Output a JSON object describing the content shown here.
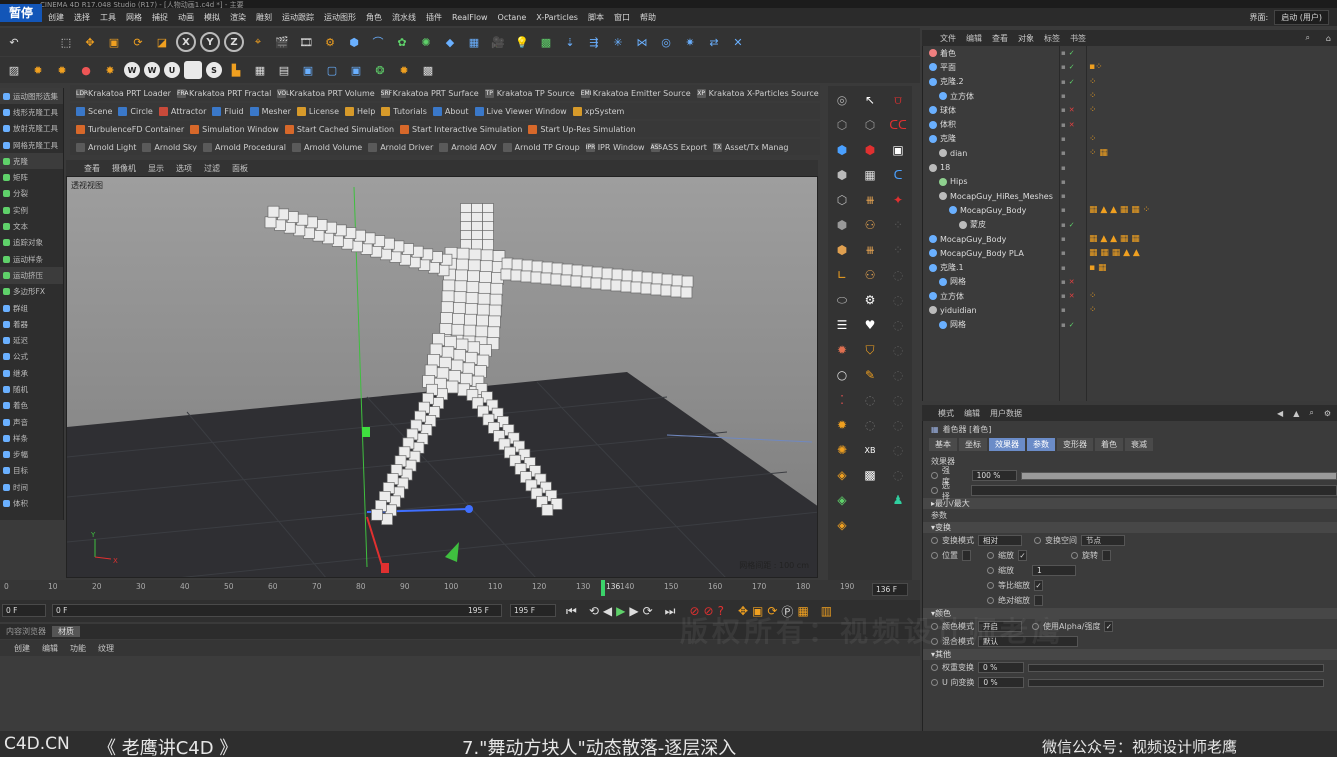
{
  "app": {
    "title": "CINEMA 4D R17.048 Studio (R17) - [人物动画1.c4d *] - 主要",
    "pause_badge": "暂停",
    "menus": [
      "创建",
      "选择",
      "工具",
      "网格",
      "捕捉",
      "动画",
      "模拟",
      "渲染",
      "雕刻",
      "运动跟踪",
      "运动图形",
      "角色",
      "流水线",
      "插件",
      "RealFlow",
      "Octane",
      "X-Particles",
      "脚本",
      "窗口",
      "帮助"
    ],
    "layout_label": "界面:",
    "layout_value": "启动 (用户)"
  },
  "plugin_bars": {
    "row1": [
      "Krakatoa PRT Loader",
      "Krakatoa PRT Fractal",
      "Krakatoa PRT Volume",
      "Krakatoa PRT Surface",
      "Krakatoa TP Source",
      "Krakatoa Emitter Source",
      "Krakatoa X-Particles Source"
    ],
    "row1_badges": [
      "LDR",
      "FRA",
      "VOL",
      "SRF",
      "TP",
      "EMI",
      "XP"
    ],
    "row2": [
      "Scene",
      "Circle",
      "Attractor",
      "Fluid",
      "Mesher",
      "License",
      "Help",
      "Tutorials",
      "About",
      "Live Viewer Window",
      "xpSystem"
    ],
    "row3": [
      "TurbulenceFD Container",
      "Simulation Window",
      "Start Cached Simulation",
      "Start Interactive Simulation",
      "Start Up-Res Simulation"
    ],
    "row4": [
      "Arnold Light",
      "Arnold Sky",
      "Arnold Procedural",
      "Arnold Volume",
      "Arnold Driver",
      "Arnold AOV",
      "Arnold TP Group",
      "IPR Window",
      "ASS Export",
      "Asset/Tx Manag"
    ],
    "row4_badges": [
      "IPR",
      "ASS",
      "TX"
    ]
  },
  "left_panel": {
    "items": [
      "运动图形选集",
      "线形克隆工具",
      "放射克隆工具",
      "网格克隆工具",
      "克隆",
      "矩阵",
      "分裂",
      "实例",
      "文本",
      "追踪对象",
      "运动样条",
      "运动挤压",
      "多边形FX",
      "群组",
      "着器",
      "延迟",
      "公式",
      "继承",
      "随机",
      "着色",
      "声音",
      "样条",
      "步幅",
      "目标",
      "时间",
      "体积"
    ]
  },
  "viewport": {
    "menu": [
      "查看",
      "摄像机",
      "显示",
      "选项",
      "过滤",
      "面板"
    ],
    "label": "透视视图",
    "grid_label": "网格间距 : 100 cm",
    "axis_y": "Y",
    "axis_x": "X"
  },
  "object_manager": {
    "menu": [
      "文件",
      "编辑",
      "查看",
      "对象",
      "标签",
      "书签"
    ],
    "rows": [
      {
        "name": "着色",
        "indent": 0,
        "color": "#f08080",
        "flags": "✓",
        "tags": ""
      },
      {
        "name": "平面",
        "indent": 0,
        "color": "#6ab0ff",
        "flags": "✓",
        "tags": "▪⁘"
      },
      {
        "name": "克隆.2",
        "indent": 0,
        "color": "#6ab0ff",
        "flags": "✓",
        "tags": "⁘"
      },
      {
        "name": "立方体",
        "indent": 1,
        "color": "#6ab0ff",
        "flags": "",
        "tags": "⁘"
      },
      {
        "name": "球体",
        "indent": 0,
        "color": "#6ab0ff",
        "flags": "✕",
        "tags": "⁘"
      },
      {
        "name": "体积",
        "indent": 0,
        "color": "#6ab0ff",
        "flags": "✕",
        "tags": ""
      },
      {
        "name": "克隆",
        "indent": 0,
        "color": "#6ab0ff",
        "flags": "",
        "tags": "⁘"
      },
      {
        "name": "dian",
        "indent": 1,
        "color": "#bbbbbb",
        "flags": "",
        "tags": "⁘ ▦"
      },
      {
        "name": "18",
        "indent": 0,
        "color": "#bbbbbb",
        "flags": "",
        "tags": ""
      },
      {
        "name": "Hips",
        "indent": 1,
        "color": "#8fd18f",
        "flags": "",
        "tags": ""
      },
      {
        "name": "MocapGuy_HiRes_Meshes",
        "indent": 1,
        "color": "#bbbbbb",
        "flags": "",
        "tags": ""
      },
      {
        "name": "MocapGuy_Body",
        "indent": 2,
        "color": "#6ab0ff",
        "flags": "",
        "tags": "▦ ▲ ▲ ▦ ▦ ⁘"
      },
      {
        "name": "蒙皮",
        "indent": 3,
        "color": "#bbbbbb",
        "flags": "✓",
        "tags": ""
      },
      {
        "name": "MocapGuy_Body",
        "indent": 0,
        "color": "#6ab0ff",
        "flags": "",
        "tags": "▦ ▲ ▲ ▦ ▦"
      },
      {
        "name": "MocapGuy_Body PLA",
        "indent": 0,
        "color": "#6ab0ff",
        "flags": "",
        "tags": "▦ ▦ ▦ ▲ ▲"
      },
      {
        "name": "克隆.1",
        "indent": 0,
        "color": "#6ab0ff",
        "flags": "",
        "tags": "▪ ▦"
      },
      {
        "name": "网格",
        "indent": 1,
        "color": "#6ab0ff",
        "flags": "✕",
        "tags": ""
      },
      {
        "name": "立方体",
        "indent": 0,
        "color": "#6ab0ff",
        "flags": "✕",
        "tags": "⁘"
      },
      {
        "name": "yiduidian",
        "indent": 0,
        "color": "#bbbbbb",
        "flags": "",
        "tags": "⁘"
      },
      {
        "name": "网格",
        "indent": 1,
        "color": "#6ab0ff",
        "flags": "✓",
        "tags": ""
      }
    ]
  },
  "attributes": {
    "menu": [
      "模式",
      "编辑",
      "用户数据"
    ],
    "object_title": "着色器 [着色]",
    "tabs": [
      "基本",
      "坐标",
      "效果器",
      "参数",
      "变形器",
      "着色",
      "衰减"
    ],
    "active_tab_index": 3,
    "section_effector": "效果器",
    "strength_label": "强度",
    "strength_value": "100 %",
    "strength_fraction": 1.0,
    "selection_label": "选择",
    "minmax_label": "最小/最大",
    "params_label": "参数",
    "transform_section": "变换",
    "transform_mode_label": "变换模式",
    "transform_mode_value": "相对",
    "transform_space_label": "变换空间",
    "transform_space_value": "节点",
    "position_label": "位置",
    "scale_label": "缩放",
    "rotate_label": "旋转",
    "scale_sub_label": "缩放",
    "scale_sub_value": "1",
    "uniform_label": "等比缩放",
    "absolute_label": "绝对缩放",
    "color_section": "颜色",
    "color_mode_label": "颜色模式",
    "color_mode_value": "开启",
    "use_alpha_label": "使用Alpha/强度",
    "blend_label": "混合模式",
    "blend_value": "默认",
    "other_section": "其他",
    "weight_label": "权重变换",
    "weight_value": "0 %",
    "u_label": "U 向变换",
    "u_value": "0 %"
  },
  "timeline": {
    "ticks": [
      "0",
      "10",
      "20",
      "30",
      "40",
      "50",
      "60",
      "70",
      "80",
      "90",
      "100",
      "110",
      "120",
      "130",
      "140",
      "150",
      "160",
      "170",
      "180",
      "190"
    ],
    "current_frame_label": "136 F",
    "playhead_label": "136",
    "start_field": "0 F",
    "range_start": "0 F",
    "range_end": "195 F",
    "end_field": "195 F"
  },
  "material": {
    "tabs": [
      "内容浏览器",
      "材质"
    ],
    "menu": [
      "创建",
      "编辑",
      "功能",
      "纹理"
    ]
  },
  "caption": {
    "site": "C4D.CN",
    "series": "《 老鹰讲C4D 》",
    "lesson": "7.\"舞动方块人\"动态散落-逐层深入",
    "wechat": "微信公众号：视频设计师老鹰",
    "watermark": "版权所有：视频设计师老鹰"
  }
}
